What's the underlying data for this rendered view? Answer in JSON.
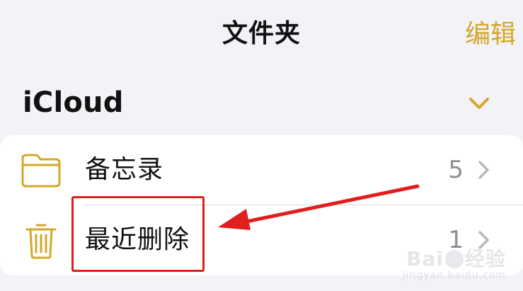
{
  "nav": {
    "title": "文件夹",
    "edit_label": "编辑"
  },
  "section": {
    "title": "iCloud",
    "toggle_icon": "chevron-down-icon"
  },
  "folders": [
    {
      "icon": "folder-icon",
      "label": "备忘录",
      "count": "5",
      "chevron_icon": "chevron-right-icon"
    },
    {
      "icon": "trash-icon",
      "label": "最近删除",
      "count": "1",
      "chevron_icon": "chevron-right-icon"
    }
  ],
  "annotation": {
    "target": "最近删除",
    "color": "#e11d1d"
  },
  "watermark": {
    "logo": "Bai du 经验",
    "site": "jingyan.baidu.com"
  },
  "theme": {
    "accent": "#d4a72c",
    "background": "#f2f2f7",
    "card": "#ffffff",
    "secondary_text": "#8e8e93"
  }
}
